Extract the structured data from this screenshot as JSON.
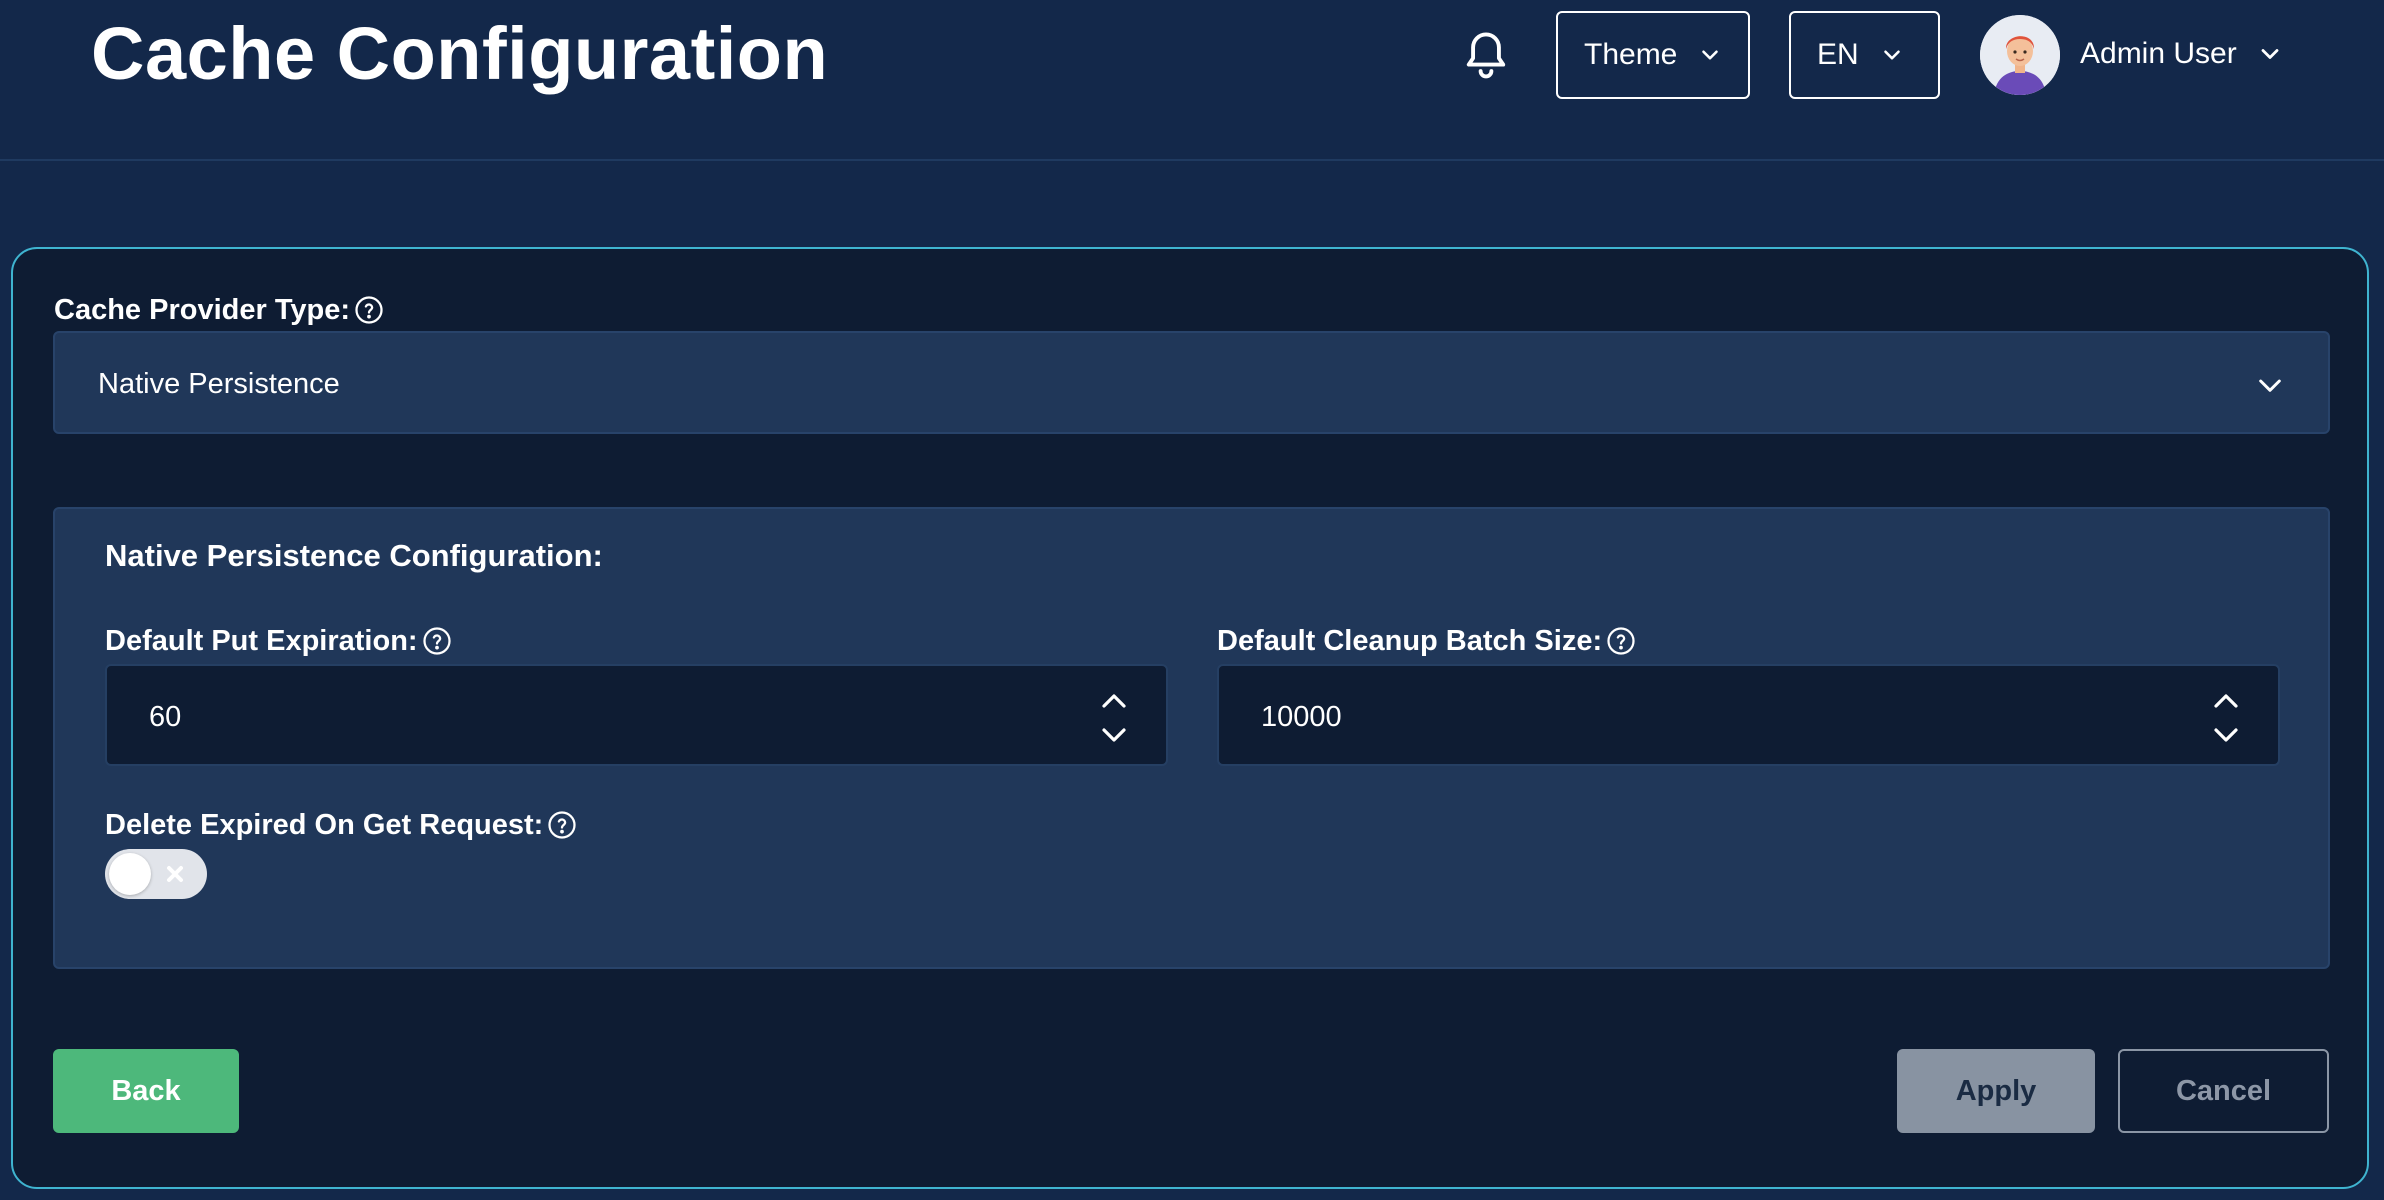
{
  "header": {
    "title": "Cache Configuration",
    "theme_label": "Theme",
    "language_label": "EN",
    "user_name": "Admin User"
  },
  "provider": {
    "label": "Cache Provider Type:",
    "selected": "Native Persistence"
  },
  "config": {
    "section_title": "Native Persistence Configuration:",
    "put_expiration": {
      "label": "Default Put Expiration:",
      "value": "60"
    },
    "cleanup_batch": {
      "label": "Default Cleanup Batch Size:",
      "value": "10000"
    },
    "delete_expired": {
      "label": "Delete Expired On Get Request:",
      "enabled": false
    }
  },
  "actions": {
    "back": "Back",
    "apply": "Apply",
    "cancel": "Cancel"
  },
  "colors": {
    "background": "#13284a",
    "card": "#0e1c33",
    "panel": "#203759",
    "card_border": "#3fb4d0",
    "back_button": "#4db87b",
    "apply_button_disabled": "#8893a2"
  },
  "icons": [
    "bell-icon",
    "chevron-down-icon",
    "help-icon",
    "stepper-icon",
    "close-icon"
  ]
}
